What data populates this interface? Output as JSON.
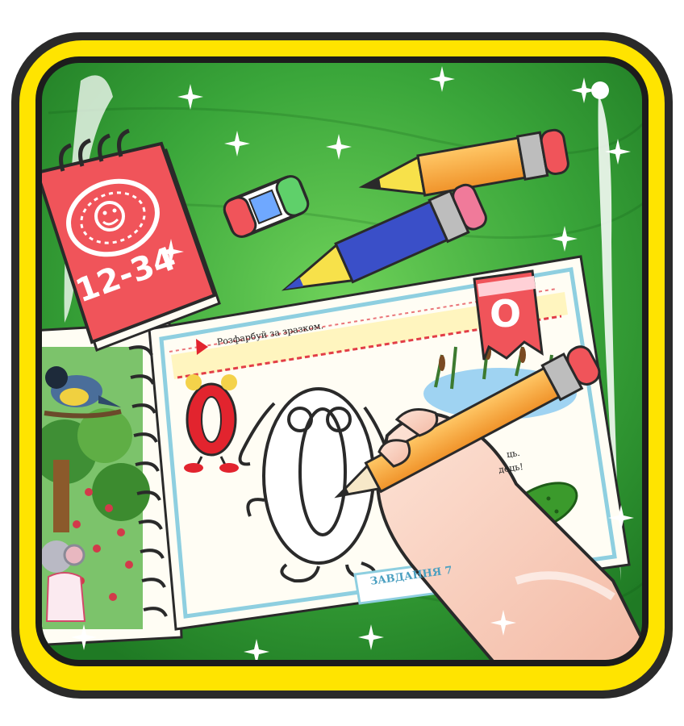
{
  "icon": {
    "colors": {
      "frame_yellow": "#ffe400",
      "frame_dark": "#2a2a2a",
      "felt_green": "#3aa63a",
      "felt_light": "#6fd25a",
      "notepad_red": "#f0545a",
      "pencil_orange": "#f08a24",
      "pencil_blue": "#3a4fc8",
      "pencil_yellow_tip": "#f7e14a",
      "page_cream": "#fffdf4",
      "letter_red": "#e2242e"
    },
    "notepad": {
      "numbers": "12-34"
    },
    "tab": {
      "letter": "О"
    },
    "workbook": {
      "instruction": "Розфарбуй за зразком.",
      "big_letter": "О",
      "footer_label": "ЗАВДАННЯ 7",
      "side_text_1": "ць.",
      "side_text_2": "дець!"
    },
    "icons": [
      "sparkle-icon",
      "pencil-icon",
      "eraser-icon",
      "notepad-icon",
      "hand-icon",
      "letter-o-icon",
      "cucumber-icon",
      "bird-icon",
      "mouse-icon"
    ]
  }
}
